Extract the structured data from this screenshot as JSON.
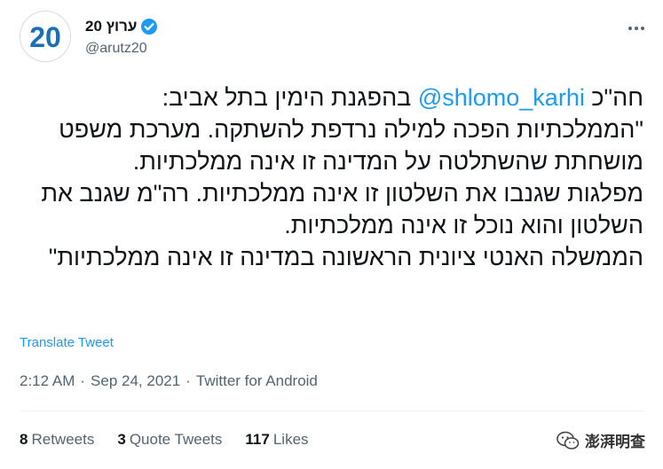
{
  "profile": {
    "display_name": "ערוץ 20",
    "handle": "@arutz20",
    "avatar_text": "20",
    "verified_icon": "verified-badge-icon",
    "more_icon": "more-options-icon"
  },
  "tweet": {
    "line1_prefix": "חה\"כ ",
    "mention": "@shlomo_karhi",
    "line1_suffix": " בהפגנת הימין בתל אביב:",
    "text": "\"הממלכתיות הפכה למילה נרדפת להשתקה. מערכת משפט מושחתת שהשתלטה על המדינה זו אינה ממלכתיות.\nמפלגות שגנבו את השלטון זו אינה ממלכתיות. רה\"מ שגנב את השלטון והוא נוכל זו אינה ממלכתיות.\nהממשלה האנטי ציונית הראשונה במדינה זו אינה ממלכתיות\""
  },
  "translate_label": "Translate Tweet",
  "meta": {
    "time": "2:12 AM",
    "date": "Sep 24, 2021",
    "source": "Twitter for Android",
    "separator": "·"
  },
  "stats": {
    "retweets_count": "8",
    "retweets_label": "Retweets",
    "quotes_count": "3",
    "quotes_label": "Quote Tweets",
    "likes_count": "117",
    "likes_label": "Likes"
  },
  "watermark": {
    "text": "澎湃明查",
    "icon": "wechat-icon"
  },
  "colors": {
    "accent": "#1d9bf0",
    "secondary_text": "#536471",
    "avatar_blue": "#1a6fb8"
  }
}
